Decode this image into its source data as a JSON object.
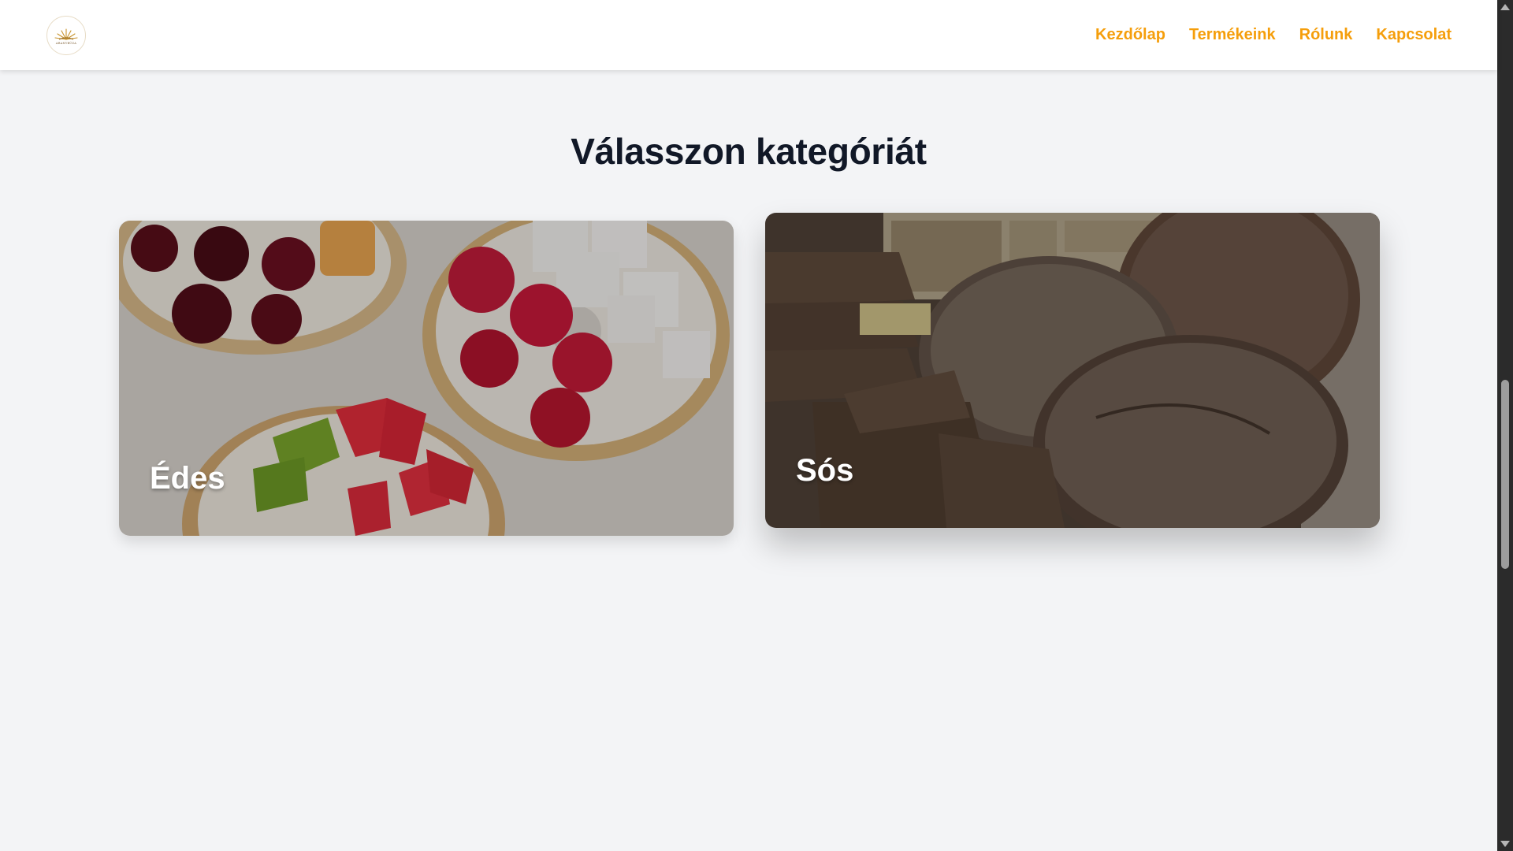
{
  "header": {
    "logo_icon": "sunburst-logo-icon",
    "logo_text": "ARANYBÚZA",
    "nav": [
      {
        "label": "Kezdőlap"
      },
      {
        "label": "Termékeink"
      },
      {
        "label": "Rólunk"
      },
      {
        "label": "Kapcsolat"
      }
    ],
    "accent_color": "#f59e0b"
  },
  "main": {
    "title": "Válasszon kategóriát",
    "categories": [
      {
        "label": "Édes",
        "image": "fruit-topped-bagels-photo"
      },
      {
        "label": "Sós",
        "image": "rye-bread-loaves-photo"
      }
    ]
  },
  "background_color": "#f3f4f6"
}
